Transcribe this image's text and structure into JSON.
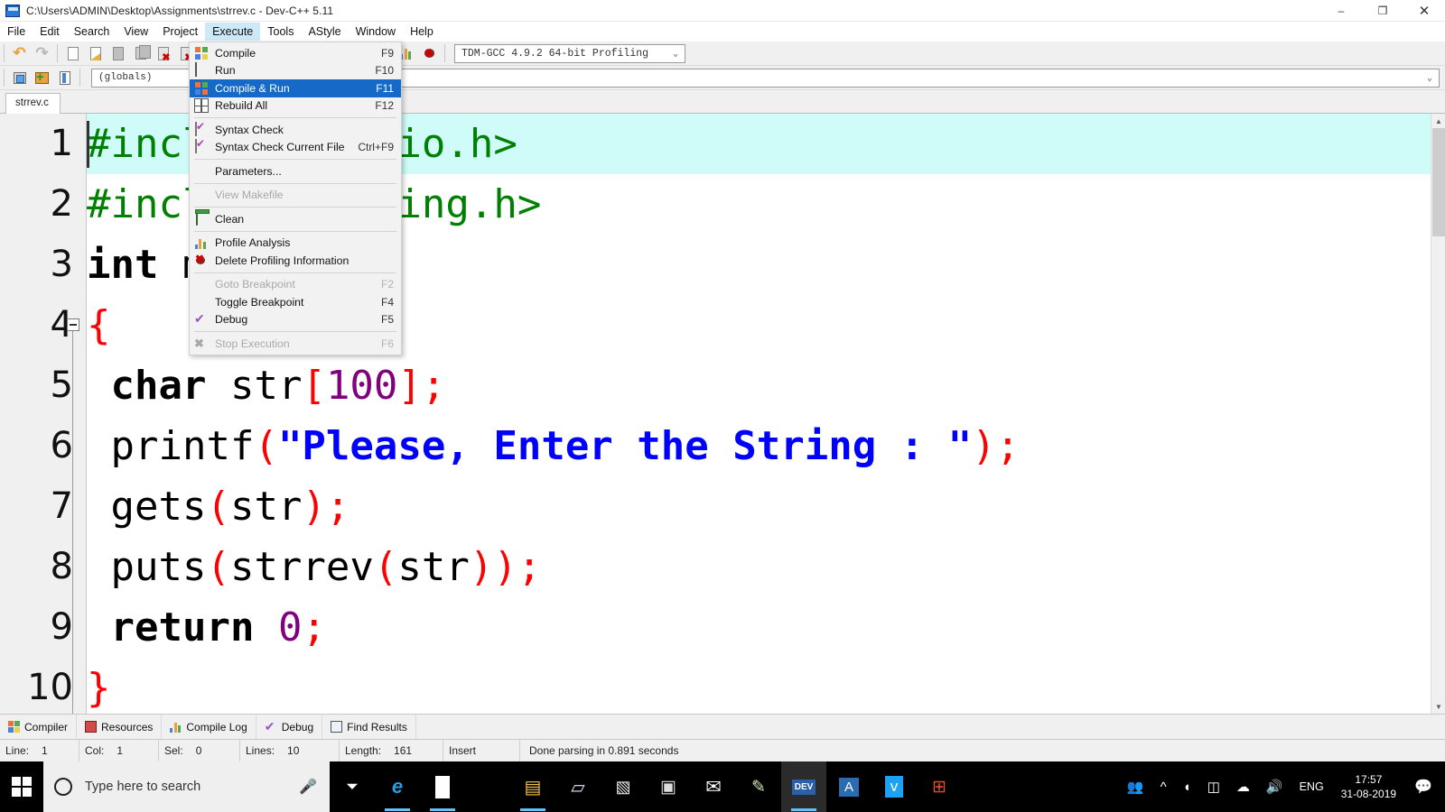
{
  "window": {
    "title": "C:\\Users\\ADMIN\\Desktop\\Assignments\\strrev.c - Dev-C++ 5.11",
    "app_icon": "devcpp-icon",
    "minimize": "–",
    "maximize": "❐",
    "close": "✕"
  },
  "menubar": {
    "items": [
      {
        "label": "File",
        "active": false
      },
      {
        "label": "Edit",
        "active": false
      },
      {
        "label": "Search",
        "active": false
      },
      {
        "label": "View",
        "active": false
      },
      {
        "label": "Project",
        "active": false
      },
      {
        "label": "Execute",
        "active": true
      },
      {
        "label": "Tools",
        "active": false
      },
      {
        "label": "AStyle",
        "active": false
      },
      {
        "label": "Window",
        "active": false
      },
      {
        "label": "Help",
        "active": false
      }
    ]
  },
  "execute_menu": {
    "items": [
      {
        "label": "Compile",
        "accel": "F9",
        "icon": "compile-icon",
        "state": "normal"
      },
      {
        "label": "Run",
        "accel": "F10",
        "icon": "run-icon",
        "state": "normal"
      },
      {
        "label": "Compile & Run",
        "accel": "F11",
        "icon": "compile-run-icon",
        "state": "selected"
      },
      {
        "label": "Rebuild All",
        "accel": "F12",
        "icon": "rebuild-icon",
        "state": "normal"
      },
      {
        "separator": true
      },
      {
        "label": "Syntax Check",
        "accel": "",
        "icon": "syntax-check-icon",
        "state": "normal"
      },
      {
        "label": "Syntax Check Current File",
        "accel": "Ctrl+F9",
        "icon": "syntax-check-file-icon",
        "state": "normal"
      },
      {
        "separator": true
      },
      {
        "label": "Parameters...",
        "accel": "",
        "icon": "none",
        "state": "normal"
      },
      {
        "separator": true
      },
      {
        "label": "View Makefile",
        "accel": "",
        "icon": "none",
        "state": "disabled"
      },
      {
        "separator": true
      },
      {
        "label": "Clean",
        "accel": "",
        "icon": "clean-icon",
        "state": "normal"
      },
      {
        "separator": true
      },
      {
        "label": "Profile Analysis",
        "accel": "",
        "icon": "profile-analysis-icon",
        "state": "normal"
      },
      {
        "label": "Delete Profiling Information",
        "accel": "",
        "icon": "delete-profiling-icon",
        "state": "normal"
      },
      {
        "separator": true
      },
      {
        "label": "Goto Breakpoint",
        "accel": "F2",
        "icon": "none",
        "state": "disabled"
      },
      {
        "label": "Toggle Breakpoint",
        "accel": "F4",
        "icon": "none",
        "state": "normal"
      },
      {
        "label": "Debug",
        "accel": "F5",
        "icon": "debug-icon",
        "state": "normal"
      },
      {
        "separator": true
      },
      {
        "label": "Stop Execution",
        "accel": "F6",
        "icon": "stop-execution-icon",
        "state": "disabled"
      }
    ]
  },
  "toolbar": {
    "compiler_set": "TDM-GCC 4.9.2 64-bit Profiling",
    "globals_value": "(globals)",
    "members_value": "",
    "caret": "⌄"
  },
  "editor": {
    "tab_label": "strrev.c",
    "lines": [
      {
        "no": "1",
        "current": true,
        "tokens": [
          {
            "t": "#include <stdio.h>",
            "c": "k-pre"
          }
        ]
      },
      {
        "no": "2",
        "current": false,
        "tokens": [
          {
            "t": "#include <string.h>",
            "c": "k-pre"
          }
        ]
      },
      {
        "no": "3",
        "current": false,
        "tokens": [
          {
            "t": "int",
            "c": "k-kw"
          },
          {
            "t": " main",
            "c": "k-id"
          },
          {
            "t": "()",
            "c": "k-pun"
          }
        ]
      },
      {
        "no": "4",
        "current": false,
        "fold": true,
        "tokens": [
          {
            "t": "{",
            "c": "k-pun"
          }
        ]
      },
      {
        "no": "5",
        "current": false,
        "tokens": [
          {
            "t": " ",
            "c": "k-id"
          },
          {
            "t": "char",
            "c": "k-kw"
          },
          {
            "t": " str",
            "c": "k-id"
          },
          {
            "t": "[",
            "c": "k-pun"
          },
          {
            "t": "100",
            "c": "k-num"
          },
          {
            "t": "];",
            "c": "k-pun"
          }
        ]
      },
      {
        "no": "6",
        "current": false,
        "tokens": [
          {
            "t": " printf",
            "c": "k-id"
          },
          {
            "t": "(",
            "c": "k-pun"
          },
          {
            "t": "\"Please, Enter the String : \"",
            "c": "k-str"
          },
          {
            "t": ");",
            "c": "k-pun"
          }
        ]
      },
      {
        "no": "7",
        "current": false,
        "tokens": [
          {
            "t": " gets",
            "c": "k-id"
          },
          {
            "t": "(",
            "c": "k-pun"
          },
          {
            "t": "str",
            "c": "k-id"
          },
          {
            "t": ");",
            "c": "k-pun"
          }
        ]
      },
      {
        "no": "8",
        "current": false,
        "tokens": [
          {
            "t": " puts",
            "c": "k-id"
          },
          {
            "t": "(",
            "c": "k-pun"
          },
          {
            "t": "strrev",
            "c": "k-id"
          },
          {
            "t": "(",
            "c": "k-pun"
          },
          {
            "t": "str",
            "c": "k-id"
          },
          {
            "t": "));",
            "c": "k-pun"
          }
        ]
      },
      {
        "no": "9",
        "current": false,
        "tokens": [
          {
            "t": " ",
            "c": "k-id"
          },
          {
            "t": "return",
            "c": "k-kw"
          },
          {
            "t": " ",
            "c": "k-id"
          },
          {
            "t": "0",
            "c": "k-num"
          },
          {
            "t": ";",
            "c": "k-pun"
          }
        ]
      },
      {
        "no": "10",
        "current": false,
        "tokens": [
          {
            "t": "}",
            "c": "k-pun"
          }
        ]
      }
    ]
  },
  "bottom_tabs": [
    {
      "label": "Compiler",
      "icon": "compiler-icon"
    },
    {
      "label": "Resources",
      "icon": "resources-icon"
    },
    {
      "label": "Compile Log",
      "icon": "compile-log-icon"
    },
    {
      "label": "Debug",
      "icon": "debug-icon"
    },
    {
      "label": "Find Results",
      "icon": "find-results-icon"
    }
  ],
  "statusbar": {
    "line_label": "Line:",
    "line_value": "1",
    "col_label": "Col:",
    "col_value": "1",
    "sel_label": "Sel:",
    "sel_value": "0",
    "lines_label": "Lines:",
    "lines_value": "10",
    "length_label": "Length:",
    "length_value": "161",
    "mode": "Insert",
    "message": "Done parsing in 0.891 seconds"
  },
  "taskbar": {
    "start_icon": "windows-logo-icon",
    "search_placeholder": "Type here to search",
    "mic_icon": "microphone-icon",
    "apps": [
      {
        "name": "task-view-icon",
        "glyph": "⏷",
        "open": false,
        "active": false
      },
      {
        "name": "edge-icon",
        "glyph": "e",
        "open": true,
        "active": false
      },
      {
        "name": "microsoft-store-icon",
        "glyph": "⊞",
        "open": true,
        "active": false
      },
      {
        "name": "chrome-icon",
        "glyph": "●",
        "open": false,
        "active": false
      },
      {
        "name": "file-explorer-icon",
        "glyph": "▤",
        "open": true,
        "active": false
      },
      {
        "name": "notepad-icon",
        "glyph": "▱",
        "open": false,
        "active": false
      },
      {
        "name": "python-icon",
        "glyph": "▧",
        "open": false,
        "active": false
      },
      {
        "name": "terminal-icon",
        "glyph": "▣",
        "open": false,
        "active": false
      },
      {
        "name": "mail-icon",
        "glyph": "✉",
        "open": false,
        "active": false
      },
      {
        "name": "paint-icon",
        "glyph": "✎",
        "open": false,
        "active": false
      },
      {
        "name": "devcpp-icon",
        "glyph": "DEV",
        "open": true,
        "active": true
      },
      {
        "name": "word-icon",
        "glyph": "A",
        "open": false,
        "active": false
      },
      {
        "name": "twitter-icon",
        "glyph": "ᴠ",
        "open": false,
        "active": false
      },
      {
        "name": "office-icon",
        "glyph": "⊞",
        "open": false,
        "active": false
      }
    ],
    "tray": {
      "people_icon": "ඞ",
      "chevron_icon": "⌃",
      "wifi_icon": "◠",
      "battery_icon": "▭",
      "onedrive_icon": "☁",
      "volume_icon": "ᴘ",
      "language": "ENG",
      "time": "17:57",
      "date": "31-08-2019",
      "action_center_icon": "□"
    }
  },
  "colors": {
    "menu_highlight": "#1569c7",
    "menu_active": "#cde8f6",
    "current_line": "#cffcf8",
    "preprocessor": "#008000",
    "string": "#0000ff",
    "number": "#800080",
    "punctuation": "#ff0000",
    "taskbar_accent": "#66c0f4"
  }
}
